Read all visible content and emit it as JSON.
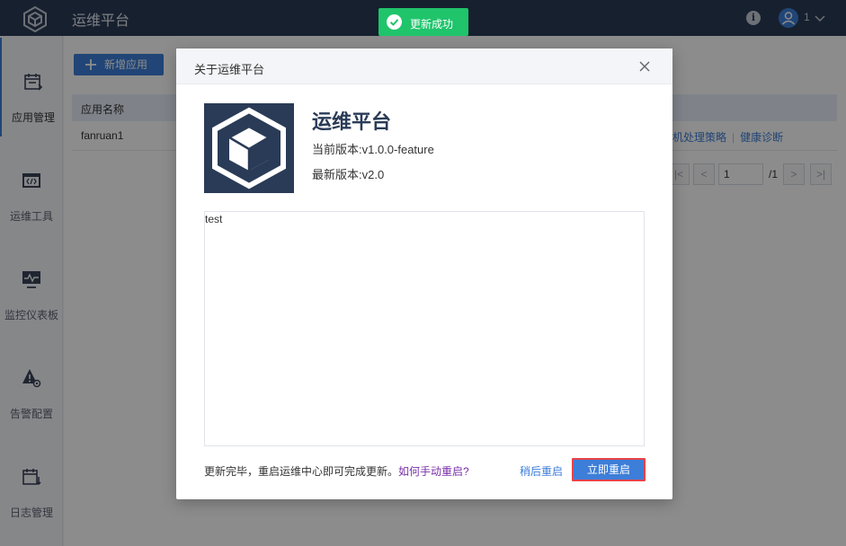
{
  "header": {
    "app_title": "运维平台",
    "info_icon": "info-icon",
    "user_name": "1"
  },
  "sidebar": {
    "items": [
      {
        "label": "应用管理",
        "icon": "calendar-icon",
        "active": true
      },
      {
        "label": "运维工具",
        "icon": "code-window-icon",
        "active": false
      },
      {
        "label": "监控仪表板",
        "icon": "monitor-pulse-icon",
        "active": false
      },
      {
        "label": "告警配置",
        "icon": "warning-gear-icon",
        "active": false
      },
      {
        "label": "日志管理",
        "icon": "log-calendar-icon",
        "active": false
      }
    ]
  },
  "main": {
    "add_button_label": "新增应用",
    "table": {
      "columns": [
        "应用名称"
      ],
      "rows": [
        {
          "name": "fanruan1",
          "actions": [
            "机处理策略",
            "健康诊断"
          ]
        }
      ]
    },
    "pager": {
      "first": "|<",
      "prev": "<",
      "page": "1",
      "total": "/1",
      "next": ">",
      "last": ">|"
    }
  },
  "toast": {
    "text": "更新成功",
    "color": "#1fc46b"
  },
  "dialog": {
    "title": "关于运维平台",
    "app_name": "运维平台",
    "current_version": "当前版本:v1.0.0-feature",
    "latest_version": "最新版本:v2.0",
    "notes": "test",
    "footer_text": "更新完毕，重启运维中心即可完成更新。",
    "footer_link": "如何手动重启?",
    "later_button": "稍后重启",
    "restart_button": "立即重启"
  },
  "colors": {
    "topbar": "#2a3b57",
    "accent": "#3d7ed8",
    "highlight_border": "#e8434a"
  }
}
